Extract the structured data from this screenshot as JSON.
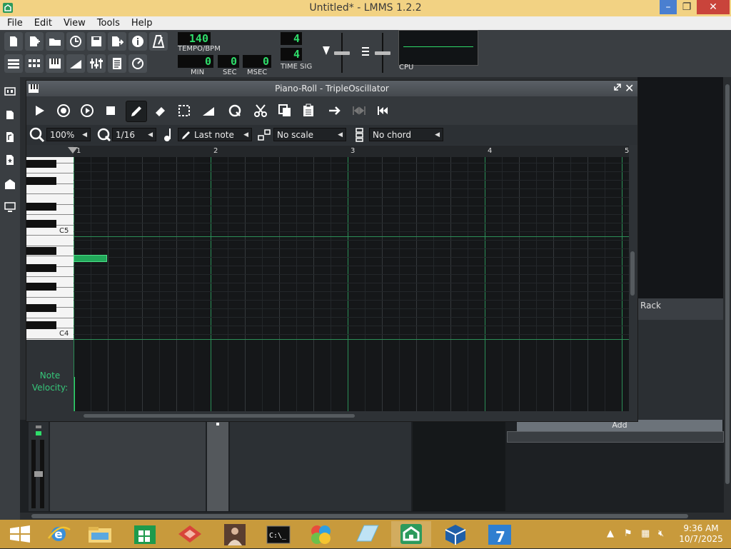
{
  "window": {
    "title": "Untitled* - LMMS 1.2.2"
  },
  "menu": [
    "File",
    "Edit",
    "View",
    "Tools",
    "Help"
  ],
  "toolbar": {
    "tempo": {
      "value": "140",
      "label": "TEMPO/BPM"
    },
    "time": {
      "min": "0",
      "sec": "0",
      "msec": "0",
      "min_label": "MIN",
      "sec_label": "SEC",
      "msec_label": "MSEC"
    },
    "time_sig": {
      "numerator": "4",
      "denominator": "4",
      "label": "TIME SIG"
    },
    "cpu_label": "CPU"
  },
  "piano_roll": {
    "title": "Piano-Roll - TripleOscillator",
    "zoom": "100%",
    "quantize": "1/16",
    "note_length": "Last note",
    "scale": "No scale",
    "chord": "No chord",
    "ruler": [
      "1",
      "2",
      "3",
      "4",
      "5"
    ],
    "key_labels": {
      "c5": "C5",
      "c4": "C4"
    },
    "velocity_label": "Note\nVelocity:"
  },
  "panels": {
    "rack": "Rack",
    "add": "Add"
  },
  "taskbar": {
    "apps": [
      "start",
      "internet-explorer",
      "file-explorer",
      "store",
      "red-app",
      "photo-app",
      "command-prompt",
      "multi-color-app",
      "notepad-app",
      "lmms",
      "virtualbox",
      "7zip"
    ],
    "time": "9:36 AM",
    "date": "10/7/2025"
  },
  "colors": {
    "accent_green": "#2fdc6a",
    "note_green": "#22a85a",
    "titlebar": "#f2d283",
    "taskbar": "#c89a3c"
  }
}
